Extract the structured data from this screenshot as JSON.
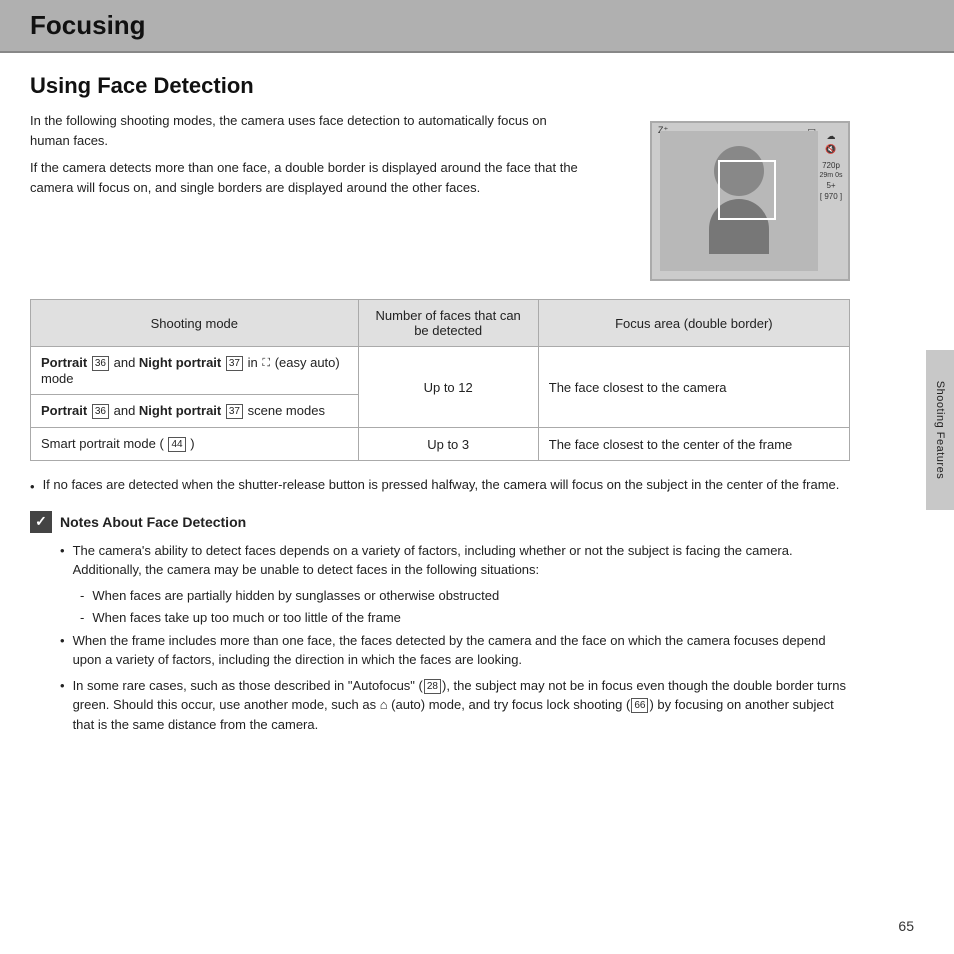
{
  "header": {
    "title": "Focusing"
  },
  "section": {
    "title": "Using Face Detection",
    "intro_p1": "In the following shooting modes, the camera uses face detection to automatically focus on human faces.",
    "intro_p2": "If the camera detects more than one face, a double border is displayed around the face that the camera will focus on, and single borders are displayed around the other faces."
  },
  "table": {
    "headers": [
      "Shooting mode",
      "Number of faces that can be detected",
      "Focus area (double border)"
    ],
    "rows": [
      {
        "shooting_mode_bold": "Portrait",
        "shooting_mode_ref1": "36",
        "shooting_mode_mid": " and ",
        "shooting_mode_bold2": "Night portrait",
        "shooting_mode_ref2": "37",
        "shooting_mode_suffix": " in",
        "shooting_mode_cam": "☆",
        "shooting_mode_end": "(easy auto) mode",
        "faces": "Up to 12",
        "focus": "The face closest to the camera",
        "rowspan": 2
      },
      {
        "shooting_mode_bold": "Portrait",
        "shooting_mode_ref1": "36",
        "shooting_mode_mid": " and ",
        "shooting_mode_bold2": "Night portrait",
        "shooting_mode_ref2": "37",
        "shooting_mode_suffix": " scene modes",
        "faces": "",
        "focus": ""
      },
      {
        "shooting_mode": "Smart portrait mode (",
        "shooting_mode_ref": "44",
        "shooting_mode_end": ")",
        "faces": "Up to 3",
        "focus": "The face closest to the center of the frame"
      }
    ]
  },
  "bullet_note": {
    "text": "If no faces are detected when the shutter-release button is pressed halfway, the camera will focus on the subject in the center of the frame."
  },
  "notes_section": {
    "title": "Notes About Face Detection",
    "icon_char": "✓",
    "items": [
      {
        "text": "The camera's ability to detect faces depends on a variety of factors, including whether or not the subject is facing the camera. Additionally, the camera may be unable to detect faces in the following situations:",
        "sub_items": [
          "When faces are partially hidden by sunglasses or otherwise obstructed",
          "When faces take up too much or too little of the frame"
        ]
      },
      {
        "text": "When the frame includes more than one face, the faces detected by the camera and the face on which the camera focuses depend upon a variety of factors, including the direction in which the faces are looking."
      },
      {
        "text": "In some rare cases, such as those described in \"Autofocus\" (□□ 28), the subject may not be in focus even though the double border turns green. Should this occur, use another mode, such as ⌂ (auto) mode, and try focus lock shooting (□□ 66) by focusing on another subject that is the same distance from the camera."
      }
    ]
  },
  "side_tab": {
    "text": "Shooting Features"
  },
  "page_number": "65"
}
